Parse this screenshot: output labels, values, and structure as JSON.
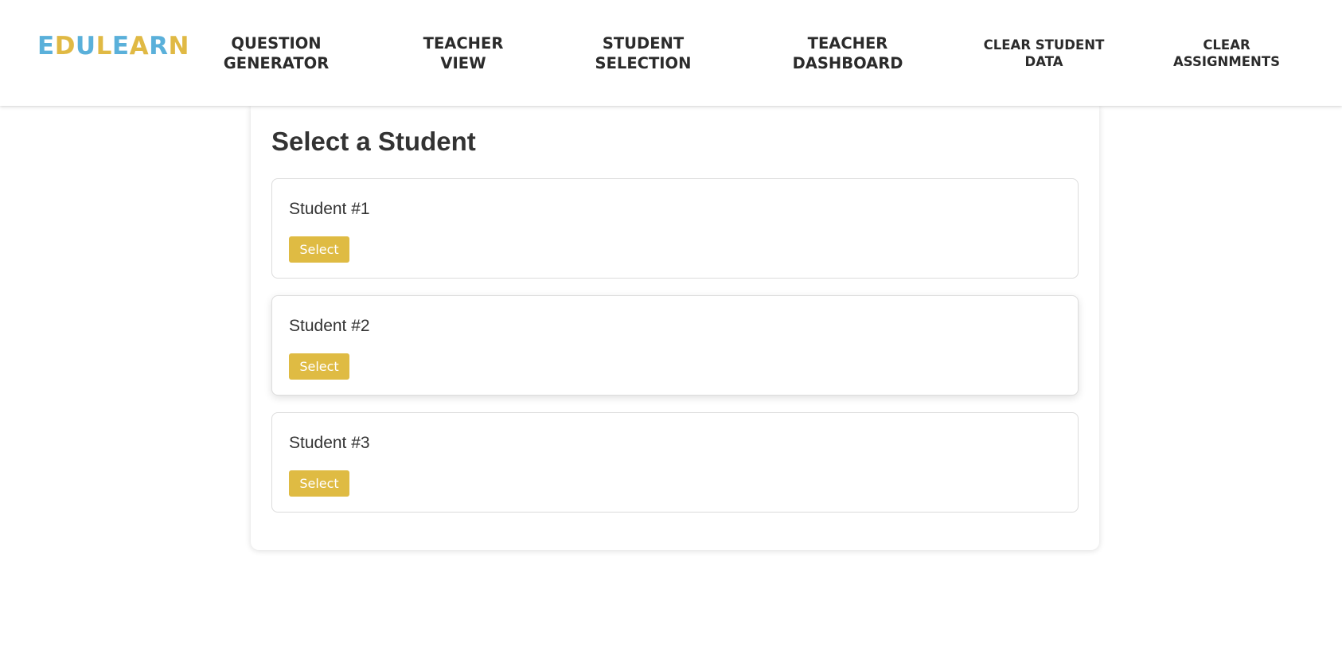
{
  "brand": {
    "letters": [
      {
        "char": "E",
        "color": "#5ab0da"
      },
      {
        "char": "D",
        "color": "#e0b944"
      },
      {
        "char": "U",
        "color": "#5ab0da"
      },
      {
        "char": "L",
        "color": "#e0b944"
      },
      {
        "char": "E",
        "color": "#5ab0da"
      },
      {
        "char": "A",
        "color": "#e0b944"
      },
      {
        "char": "R",
        "color": "#5ab0da"
      },
      {
        "char": "N",
        "color": "#e0b944"
      }
    ]
  },
  "nav": {
    "question_generator": [
      "QUESTION",
      "GENERATOR"
    ],
    "teacher_view": [
      "TEACHER",
      "VIEW"
    ],
    "student_selection": [
      "STUDENT",
      "SELECTION"
    ],
    "teacher_dashboard": [
      "TEACHER",
      "DASHBOARD"
    ],
    "clear_student_data": [
      "CLEAR STUDENT",
      "DATA"
    ],
    "clear_assignments": [
      "CLEAR",
      "ASSIGNMENTS"
    ]
  },
  "main": {
    "title": "Select a Student",
    "students": [
      {
        "name": "Student #1",
        "button_label": "Select"
      },
      {
        "name": "Student #2",
        "button_label": "Select"
      },
      {
        "name": "Student #3",
        "button_label": "Select"
      }
    ]
  },
  "colors": {
    "accent_yellow": "#dfbb43",
    "accent_blue": "#5ab0da",
    "text": "#333333"
  }
}
